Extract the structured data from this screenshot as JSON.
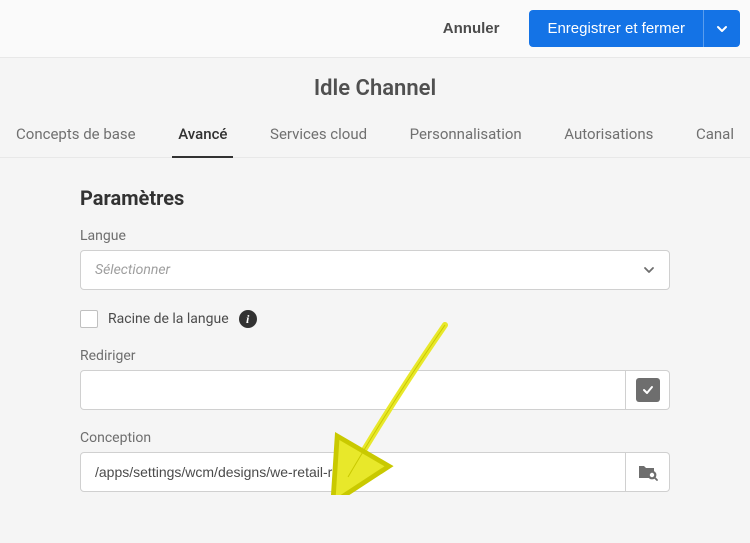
{
  "header": {
    "cancel_label": "Annuler",
    "save_label": "Enregistrer et fermer"
  },
  "page_title": "Idle Channel",
  "tabs": [
    {
      "label": "Concepts de base",
      "active": false
    },
    {
      "label": "Avancé",
      "active": true
    },
    {
      "label": "Services cloud",
      "active": false
    },
    {
      "label": "Personnalisation",
      "active": false
    },
    {
      "label": "Autorisations",
      "active": false
    },
    {
      "label": "Canal",
      "active": false
    }
  ],
  "section_heading": "Paramètres",
  "fields": {
    "language": {
      "label": "Langue",
      "placeholder": "Sélectionner"
    },
    "language_root": {
      "label": "Racine de la langue",
      "checked": false
    },
    "redirect": {
      "label": "Rediriger",
      "value": ""
    },
    "design": {
      "label": "Conception",
      "value": "/apps/settings/wcm/designs/we-retail-run"
    }
  }
}
